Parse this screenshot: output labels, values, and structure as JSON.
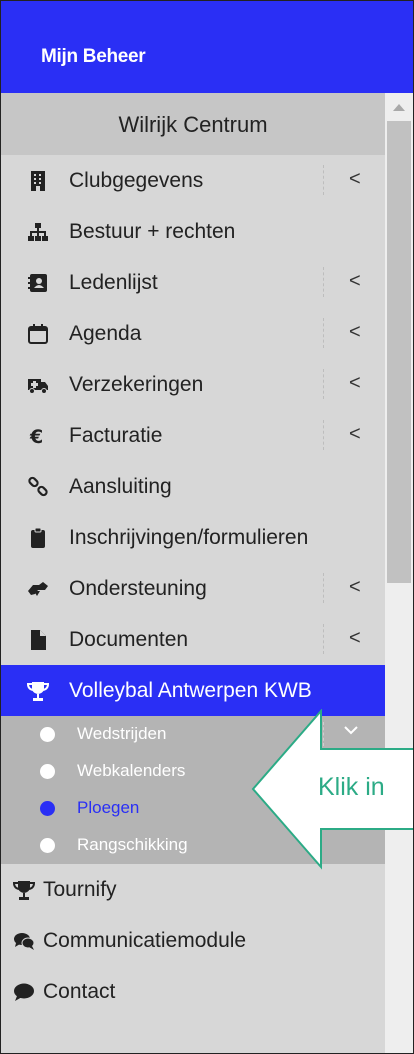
{
  "header": {
    "title": "Mijn Beheer"
  },
  "club": {
    "name": "Wilrijk Centrum"
  },
  "menu": [
    {
      "label": "Clubgegevens",
      "icon": "building-icon",
      "chevron": "<"
    },
    {
      "label": "Bestuur + rechten",
      "icon": "org-chart-icon",
      "chevron": ""
    },
    {
      "label": "Ledenlijst",
      "icon": "address-book-icon",
      "chevron": "<"
    },
    {
      "label": "Agenda",
      "icon": "calendar-icon",
      "chevron": "<"
    },
    {
      "label": "Verzekeringen",
      "icon": "ambulance-icon",
      "chevron": "<"
    },
    {
      "label": "Facturatie",
      "icon": "euro-icon",
      "chevron": "<"
    },
    {
      "label": "Aansluiting",
      "icon": "link-icon",
      "chevron": ""
    },
    {
      "label": "Inschrijvingen/formulieren",
      "icon": "clipboard-icon",
      "chevron": ""
    },
    {
      "label": "Ondersteuning",
      "icon": "handshake-icon",
      "chevron": "<"
    },
    {
      "label": "Documenten",
      "icon": "file-icon",
      "chevron": "<"
    },
    {
      "label": "Volleybal Antwerpen KWB",
      "icon": "trophy-icon",
      "chevron": ""
    }
  ],
  "submenu": [
    {
      "label": "Wedstrijden",
      "chevron": "v"
    },
    {
      "label": "Webkalenders"
    },
    {
      "label": "Ploegen",
      "selected": true
    },
    {
      "label": "Rangschikking"
    }
  ],
  "menu_bottom": [
    {
      "label": "Tournify",
      "icon": "trophy-icon"
    },
    {
      "label": "Communicatiemodule",
      "icon": "comments-icon"
    },
    {
      "label": "Contact",
      "icon": "comment-icon"
    }
  ],
  "callout": {
    "text": "Klik in",
    "color": "#2cab86"
  },
  "colors": {
    "accent": "#2a2ff5",
    "sidebar": "#d7d7d7",
    "submenu": "#b4b4b4"
  }
}
